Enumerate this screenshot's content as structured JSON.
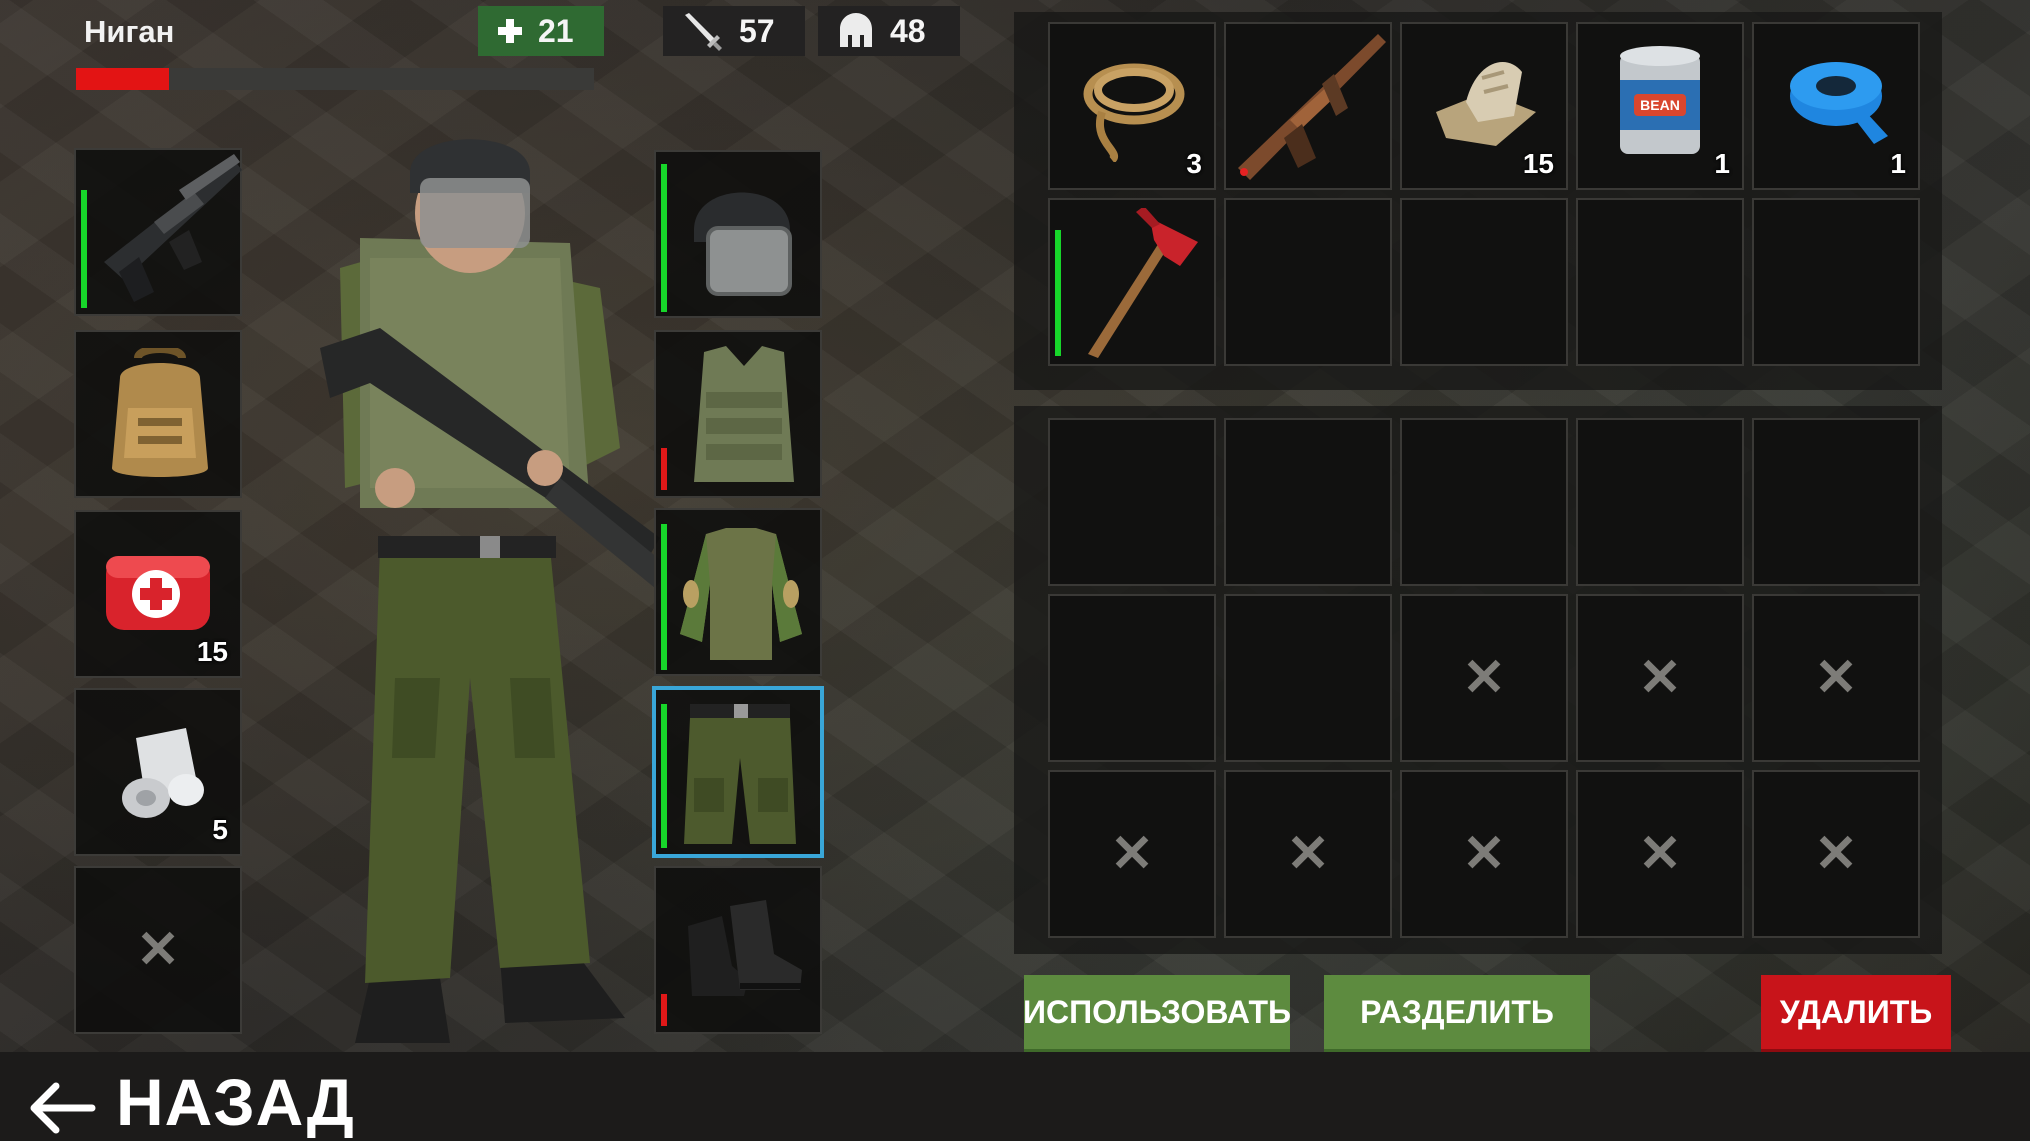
{
  "character": {
    "name": "Ниган",
    "health_fraction": 0.18,
    "stats": {
      "health": "21",
      "attack": "57",
      "armor": "48"
    }
  },
  "equipment": {
    "left": [
      {
        "item": "assault-rifle",
        "durability": "green"
      },
      {
        "item": "backpack"
      },
      {
        "item": "first-aid-kit",
        "qty": "15"
      },
      {
        "item": "bandage",
        "qty": "5"
      },
      {
        "item": "locked"
      }
    ],
    "right": [
      {
        "item": "helmet",
        "durability": "green"
      },
      {
        "item": "body-armor",
        "durability": "red"
      },
      {
        "item": "camo-shirt",
        "durability": "green"
      },
      {
        "item": "cargo-pants",
        "durability": "green",
        "selected": true
      },
      {
        "item": "boots",
        "durability": "red"
      }
    ]
  },
  "backpack_items": [
    {
      "item": "rope",
      "qty": "3"
    },
    {
      "item": "rifle"
    },
    {
      "item": "cloth",
      "qty": "15"
    },
    {
      "item": "beans-can",
      "qty": "1"
    },
    {
      "item": "duct-tape",
      "qty": "1"
    },
    {
      "item": "fire-axe",
      "durability": "green"
    }
  ],
  "buttons": {
    "use": "ИСПОЛЬЗОВАТЬ",
    "split": "РАЗДЕЛИТЬ",
    "delete": "УДАЛИТЬ"
  },
  "nav": {
    "back": "НАЗАД"
  },
  "icons": {
    "health": "plus-icon",
    "attack": "sword-icon",
    "armor": "helmet-icon",
    "back": "arrow-left-icon",
    "locked": "cross-icon"
  },
  "colors": {
    "health_bar": "#e31414",
    "health_badge": "#2f6a32",
    "durability_good": "#17d62a",
    "durability_low": "#e01818",
    "selected_border": "#39a6d8",
    "button_green": "#5d8b3f",
    "button_red": "#c8141a"
  }
}
